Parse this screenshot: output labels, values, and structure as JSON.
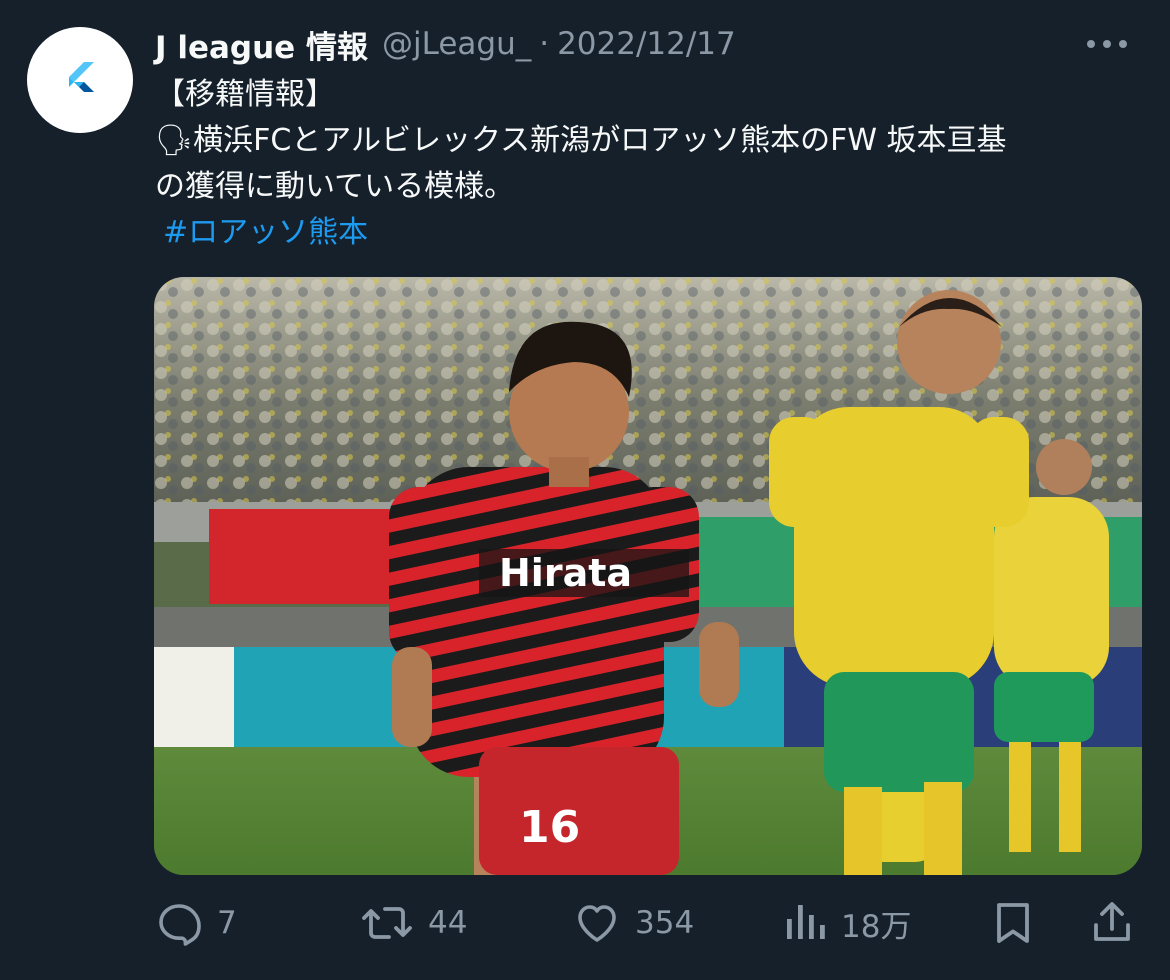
{
  "tweet": {
    "author": {
      "name": "J league 情報",
      "handle": "@jLeagu_",
      "separator": "·",
      "avatar_icon": "flutter-logo-icon"
    },
    "date": "2022/12/17",
    "text": {
      "line1": "【移籍情報】",
      "line2": "横浜FCとアルビレックス新潟がロアッソ熊本のFW 坂本亘基",
      "line3": "の獲得に動いている模様。",
      "hashtag": "#ロアッソ熊本",
      "speaker_emoji": "🗣"
    },
    "media": {
      "shirt_sponsor": "Hirata",
      "shirt_number": "16"
    }
  },
  "actions": {
    "reply_count": "7",
    "retweet_count": "44",
    "like_count": "354",
    "views_count": "18万"
  },
  "colors": {
    "background": "#15202b",
    "text": "#f7f9f9",
    "secondary_text": "#8b98a5",
    "link": "#1d9bf0",
    "avatar_bg": "#ffffff",
    "flutter_blue": "#4fc3f7"
  }
}
